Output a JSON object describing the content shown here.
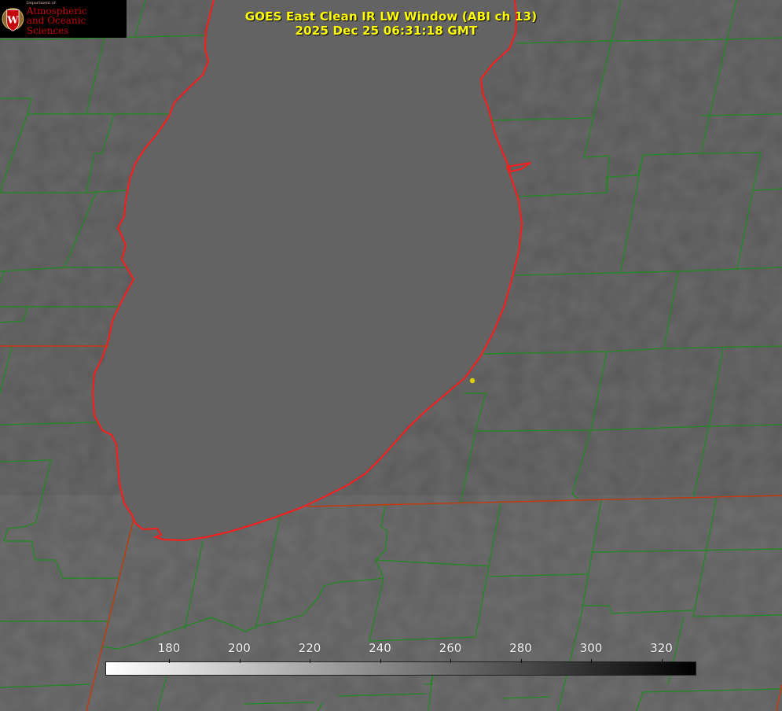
{
  "title_line1": "GOES East Clean IR LW Window (ABI ch 13)",
  "title_line2": "2025 Dec 25 06:31:18 GMT",
  "logo": {
    "dept": "Department of",
    "line1": "Atmospheric",
    "line2": "and Oceanic Sciences",
    "brand_color": "#c5050c"
  },
  "colorbar": {
    "ticks": [
      "180",
      "200",
      "220",
      "240",
      "260",
      "280",
      "300",
      "320"
    ],
    "gradient": [
      "#ffffff",
      "#000000"
    ]
  },
  "colors": {
    "county_lines": "#1f8a1f",
    "state_lines": "#c8370b",
    "lake_shore": "#ff1a1a",
    "marker": "#e0d000"
  }
}
